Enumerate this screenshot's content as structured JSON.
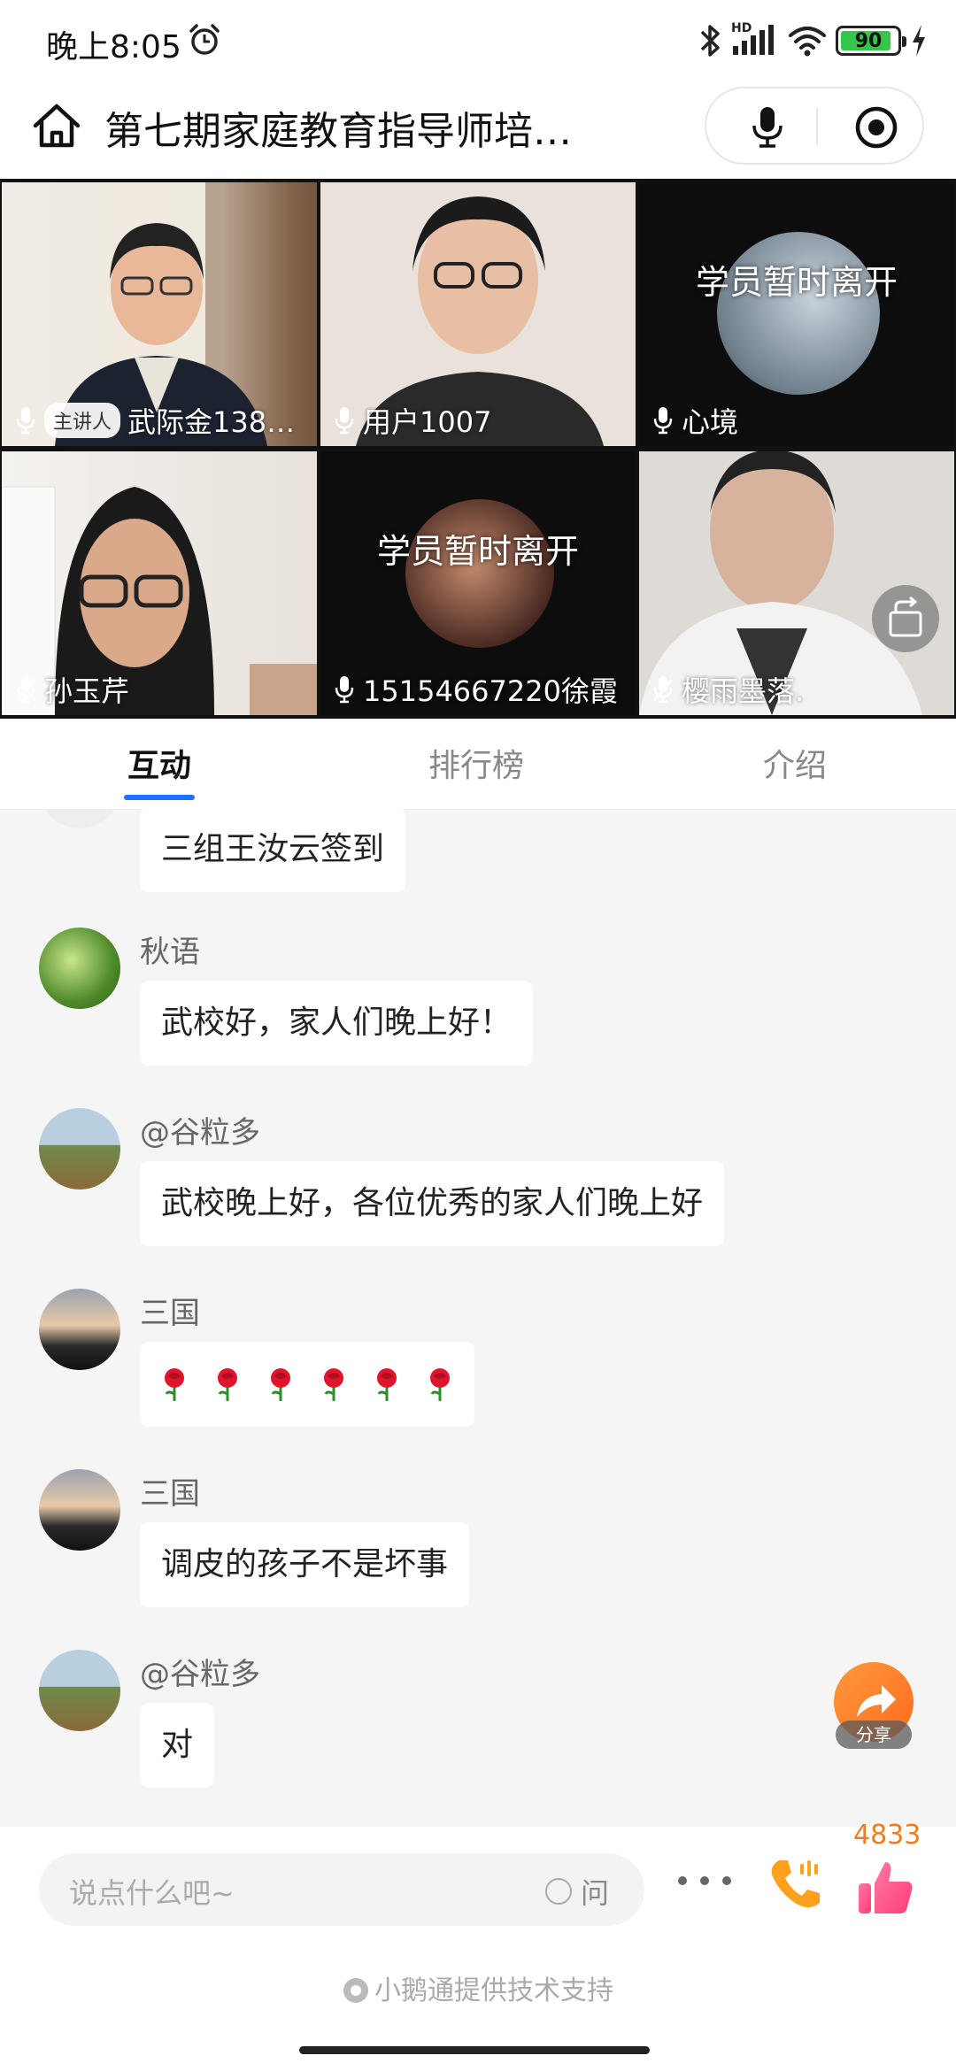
{
  "status_bar": {
    "time": "晚上8:05",
    "hd": "HD",
    "battery": "90",
    "battery_level": 0.9
  },
  "header": {
    "title": "第七期家庭教育指导师培…"
  },
  "video_tiles": [
    {
      "name": "武际金138…",
      "host_badge": "主讲人",
      "away_text": ""
    },
    {
      "name": "用户1007",
      "away_text": ""
    },
    {
      "name": "心境",
      "away_text": "学员暂时离开"
    },
    {
      "name": "孙玉芹",
      "away_text": ""
    },
    {
      "name": "15154667220徐霞",
      "away_text": "学员暂时离开"
    },
    {
      "name": "樱雨墨落.",
      "away_text": ""
    }
  ],
  "tabs": [
    {
      "label": "互动",
      "active": true
    },
    {
      "label": "排行榜",
      "active": false
    },
    {
      "label": "介绍",
      "active": false
    }
  ],
  "messages": [
    {
      "name": "",
      "text": "三组王汝云签到"
    },
    {
      "name": "秋语",
      "text": "武校好，家人们晚上好！"
    },
    {
      "name": "@谷粒多",
      "text": "武校晚上好，各位优秀的家人们晚上好"
    },
    {
      "name": "三国",
      "text": "",
      "roses": 6
    },
    {
      "name": "三国",
      "text": "调皮的孩子不是坏事"
    },
    {
      "name": "@谷粒多",
      "text": "对"
    }
  ],
  "share": {
    "label": "分享"
  },
  "bottom_bar": {
    "input_placeholder": "说点什么吧~",
    "ask_label": "问",
    "like_count": "4833",
    "credit": "小鹅通提供技术支持"
  },
  "colors": {
    "accent": "#1e6fff",
    "share": "#ff7a22",
    "like_count": "#f07d1a",
    "battery": "#34c64a"
  }
}
